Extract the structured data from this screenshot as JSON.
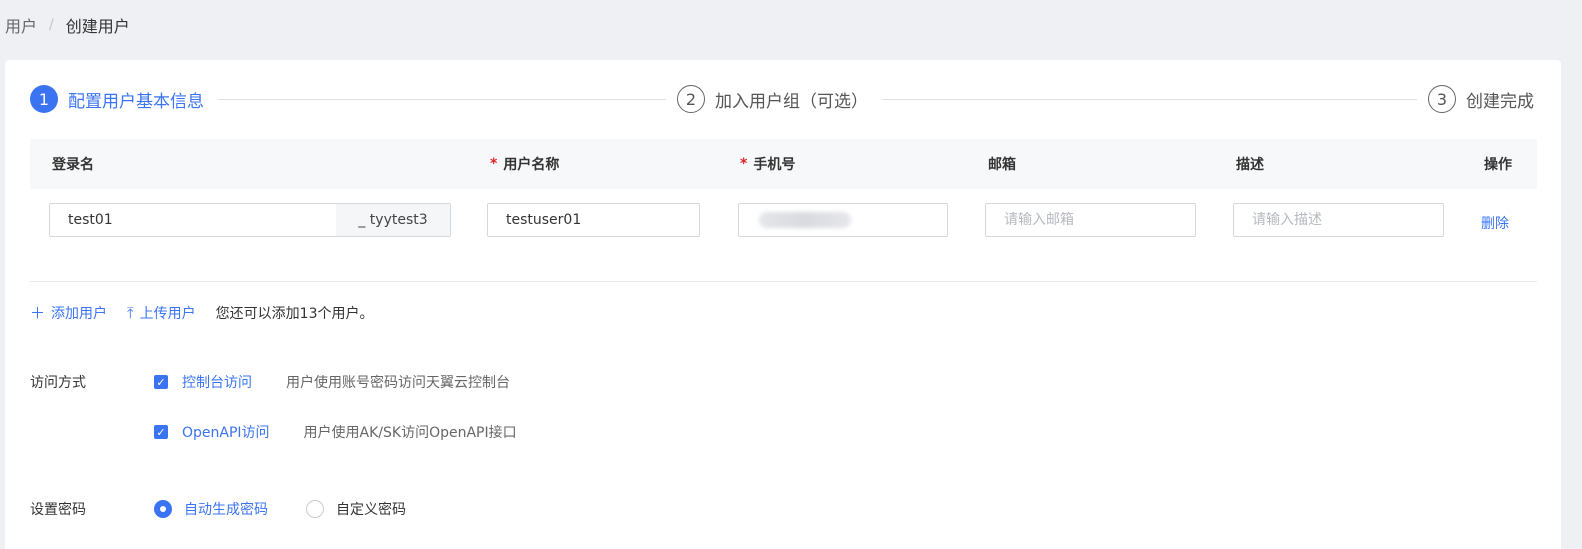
{
  "breadcrumb": {
    "parent": "用户",
    "separator": "/",
    "current": "创建用户"
  },
  "steps": [
    {
      "num": "1",
      "label": "配置用户基本信息",
      "state": "active"
    },
    {
      "num": "2",
      "label": "加入用户组（可选）",
      "state": "idle"
    },
    {
      "num": "3",
      "label": "创建完成",
      "state": "idle"
    }
  ],
  "table": {
    "headers": {
      "login_name": "登录名",
      "user_name": "用户名称",
      "phone": "手机号",
      "email": "邮箱",
      "description": "描述",
      "actions": "操作"
    },
    "required_mark": "*",
    "row": {
      "login_name": "test01",
      "login_suffix": "_ tyytest3",
      "user_name": "testuser01",
      "email_placeholder": "请输入邮箱",
      "description_placeholder": "请输入描述",
      "delete_label": "删除"
    }
  },
  "actions": {
    "add_user": "添加用户",
    "upload_user": "上传用户",
    "hint": "您还可以添加13个用户。"
  },
  "access": {
    "label": "访问方式",
    "options": [
      {
        "label": "控制台访问",
        "desc": "用户使用账号密码访问天翼云控制台",
        "checked": true
      },
      {
        "label": "OpenAPI访问",
        "desc": "用户使用AK/SK访问OpenAPI接口",
        "checked": true
      }
    ]
  },
  "password": {
    "label": "设置密码",
    "options": [
      {
        "label": "自动生成密码",
        "selected": true
      },
      {
        "label": "自定义密码",
        "selected": false
      }
    ]
  },
  "colors": {
    "accent": "#3b74f2",
    "required": "#e02020"
  }
}
